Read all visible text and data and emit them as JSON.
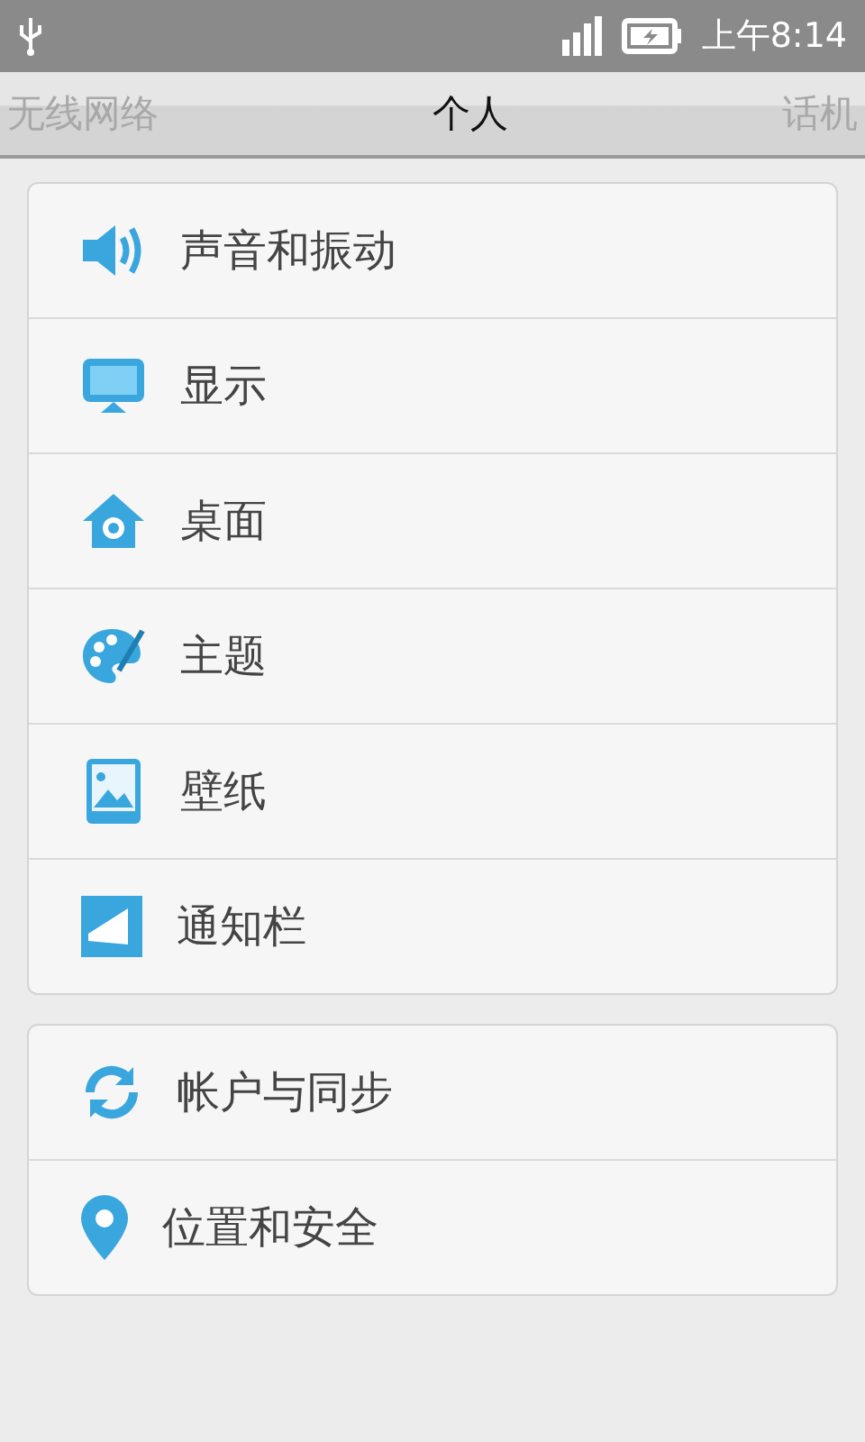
{
  "status_bar": {
    "time": "上午8:14"
  },
  "tabs": [
    {
      "label": "无线网络",
      "selected": false
    },
    {
      "label": "个人",
      "selected": true
    },
    {
      "label": "话机",
      "selected": false
    }
  ],
  "groups": [
    {
      "items": [
        {
          "label": "声音和振动"
        },
        {
          "label": "显示"
        },
        {
          "label": "桌面"
        },
        {
          "label": "主题"
        },
        {
          "label": "壁纸"
        },
        {
          "label": "通知栏"
        }
      ]
    },
    {
      "items": [
        {
          "label": "帐户与同步"
        },
        {
          "label": "位置和安全"
        }
      ]
    }
  ]
}
